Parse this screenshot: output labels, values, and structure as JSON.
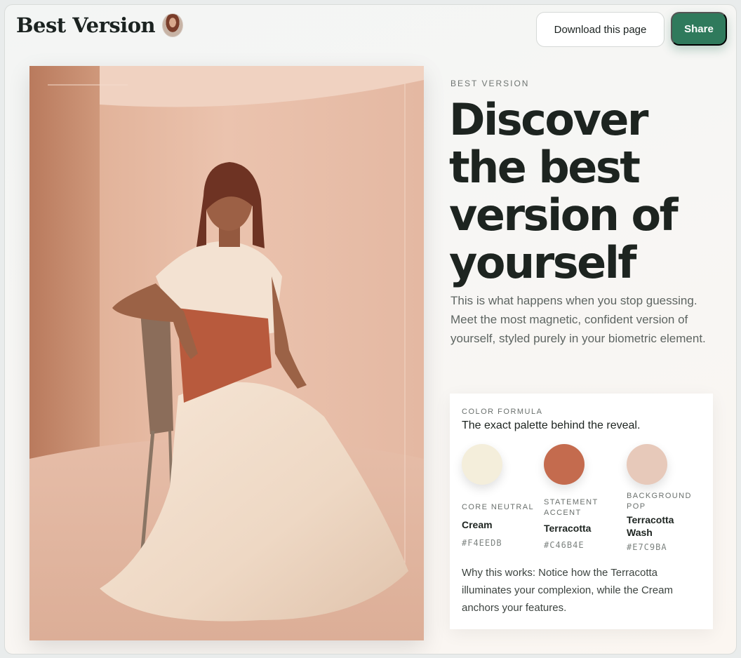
{
  "header": {
    "brand_title": "Best Version",
    "download_label": "Download this page",
    "share_label": "Share"
  },
  "hero": {
    "eyebrow": "BEST VERSION",
    "headline": "Discover the best version of yourself",
    "intro": "This is what happens when you stop guessing. Meet the most magnetic, confident version of yourself, styled purely in your biometric element."
  },
  "color_formula": {
    "eyebrow": "COLOR FORMULA",
    "title": "The exact palette behind the reveal.",
    "swatches": [
      {
        "role": "CORE NEUTRAL",
        "name": "Cream",
        "hex": "#F4EEDB"
      },
      {
        "role": "STATEMENT ACCENT",
        "name": "Terracotta",
        "hex": "#C46B4E"
      },
      {
        "role": "BACKGROUND POP",
        "name": "Terracotta Wash",
        "hex": "#E7C9BA"
      }
    ],
    "note": "Why this works: Notice how the Terracotta illuminates your complexion, while the Cream anchors your features."
  },
  "colors": {
    "brand_green": "#2f7a5c",
    "headline": "#1d2420",
    "photo_background": "#e7c4b0"
  },
  "icons": [
    "brand-avatar"
  ]
}
